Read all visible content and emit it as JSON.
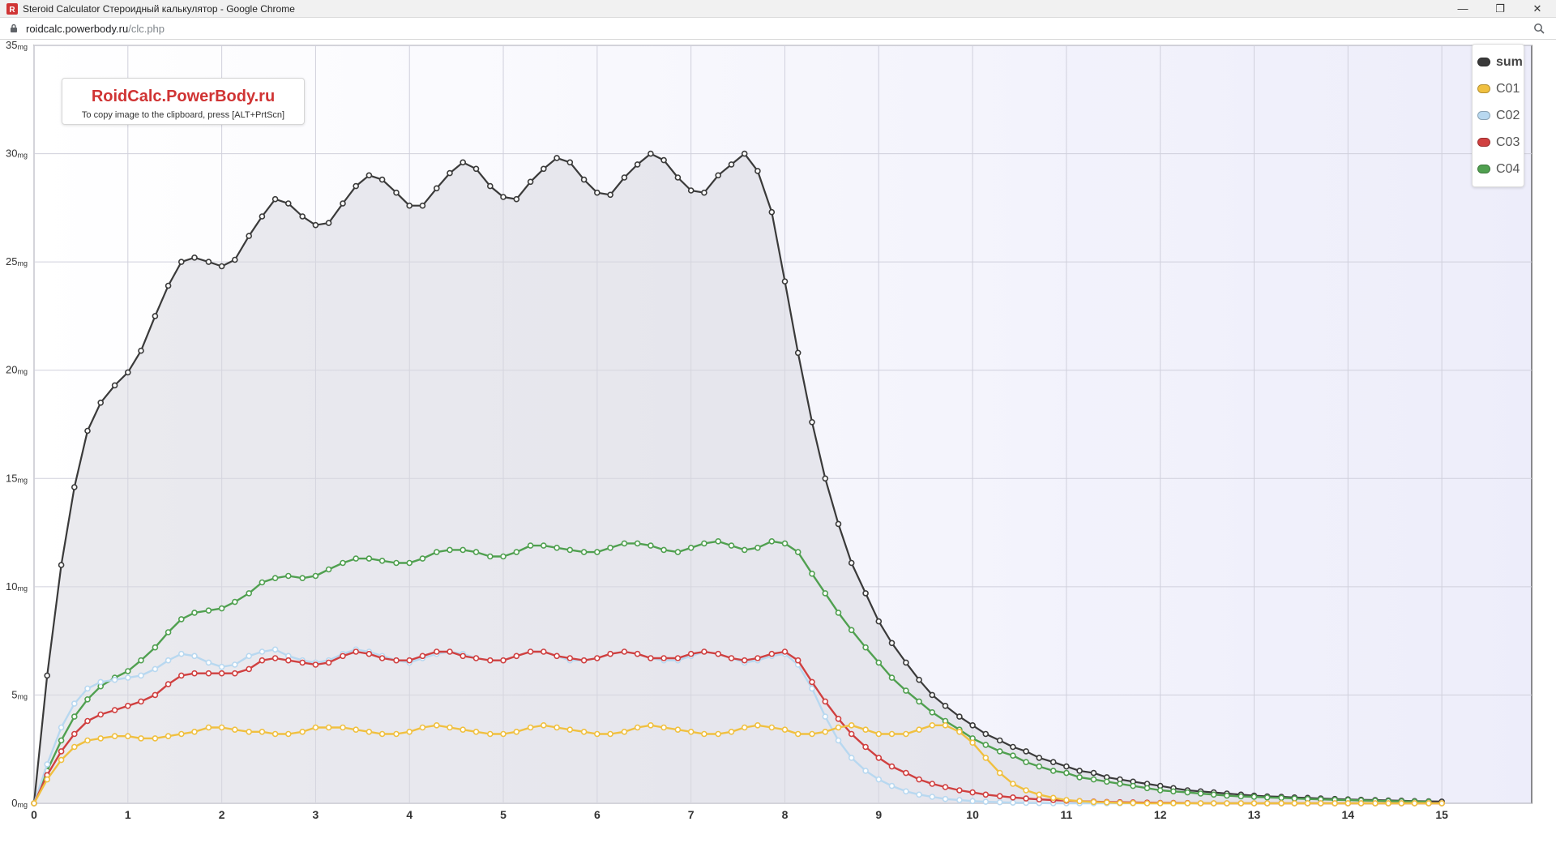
{
  "window": {
    "title": "Steroid Calculator Стероидный калькулятор - Google Chrome",
    "controls": [
      "—",
      "❐",
      "✕"
    ]
  },
  "address": {
    "host": "roidcalc.powerbody.ru",
    "path": "/clc.php"
  },
  "watermark": {
    "title": "RoidCalc.PowerBody.ru",
    "hint": "To copy image to the clipboard, press [ALT+PrtScn]"
  },
  "legend": [
    {
      "label": "sum",
      "color": "#3a3a3a"
    },
    {
      "label": "C01",
      "color": "#f0c040"
    },
    {
      "label": "C02",
      "color": "#b8d8f0"
    },
    {
      "label": "C03",
      "color": "#d04040"
    },
    {
      "label": "C04",
      "color": "#50a050"
    }
  ],
  "colors": {
    "sum": "#3a3a3a",
    "C01": "#f0c040",
    "C02": "#b8d8f0",
    "C03": "#d04040",
    "C04": "#50a050",
    "gridline": "#d0d0dc",
    "sum_fill": "#d8d8e0"
  },
  "chart_data": {
    "type": "line",
    "title": "",
    "xlabel": "",
    "ylabel": "",
    "xlim": [
      0,
      15
    ],
    "ylim": [
      0,
      35
    ],
    "x_ticks": [
      "0",
      "1",
      "2",
      "3",
      "4",
      "5",
      "6",
      "7",
      "8",
      "9",
      "10",
      "11",
      "12",
      "13",
      "14",
      "15"
    ],
    "y_ticks": [
      "0",
      "5",
      "10",
      "15",
      "20",
      "25",
      "30",
      "35"
    ],
    "y_unit": "mg",
    "grid": true,
    "legend_position": "top-right",
    "x": [
      0,
      0.14,
      0.29,
      0.43,
      0.57,
      0.71,
      0.86,
      1,
      1.14,
      1.29,
      1.43,
      1.57,
      1.71,
      1.86,
      2,
      2.14,
      2.29,
      2.43,
      2.57,
      2.71,
      2.86,
      3,
      3.14,
      3.29,
      3.43,
      3.57,
      3.71,
      3.86,
      4,
      4.14,
      4.29,
      4.43,
      4.57,
      4.71,
      4.86,
      5,
      5.14,
      5.29,
      5.43,
      5.57,
      5.71,
      5.86,
      6,
      6.14,
      6.29,
      6.43,
      6.57,
      6.71,
      6.86,
      7,
      7.14,
      7.29,
      7.43,
      7.57,
      7.71,
      7.86,
      8,
      8.14,
      8.29,
      8.43,
      8.57,
      8.71,
      8.86,
      9,
      9.14,
      9.29,
      9.43,
      9.57,
      9.71,
      9.86,
      10,
      10.14,
      10.29,
      10.43,
      10.57,
      10.71,
      10.86,
      11,
      11.14,
      11.29,
      11.43,
      11.57,
      11.71,
      11.86,
      12,
      12.14,
      12.29,
      12.43,
      12.57,
      12.71,
      12.86,
      13,
      13.14,
      13.29,
      13.43,
      13.57,
      13.71,
      13.86,
      14,
      14.14,
      14.29,
      14.43,
      14.57,
      14.71,
      14.86,
      15
    ],
    "series": [
      {
        "name": "sum",
        "values": [
          0,
          5.9,
          11.0,
          14.6,
          17.2,
          18.5,
          19.3,
          19.9,
          20.9,
          22.5,
          23.9,
          25.0,
          25.2,
          25.0,
          24.8,
          25.1,
          26.2,
          27.1,
          27.9,
          27.7,
          27.1,
          26.7,
          26.8,
          27.7,
          28.5,
          29.0,
          28.8,
          28.2,
          27.6,
          27.6,
          28.4,
          29.1,
          29.6,
          29.3,
          28.5,
          28.0,
          27.9,
          28.7,
          29.3,
          29.8,
          29.6,
          28.8,
          28.2,
          28.1,
          28.9,
          29.5,
          30.0,
          29.7,
          28.9,
          28.3,
          28.2,
          29.0,
          29.5,
          30.0,
          29.2,
          27.3,
          24.1,
          20.8,
          17.6,
          15.0,
          12.9,
          11.1,
          9.7,
          8.4,
          7.4,
          6.5,
          5.7,
          5.0,
          4.5,
          4.0,
          3.6,
          3.2,
          2.9,
          2.6,
          2.4,
          2.1,
          1.9,
          1.7,
          1.5,
          1.4,
          1.2,
          1.1,
          1.0,
          0.9,
          0.8,
          0.7,
          0.6,
          0.55,
          0.5,
          0.45,
          0.4,
          0.35,
          0.32,
          0.3,
          0.27,
          0.25,
          0.22,
          0.2,
          0.18,
          0.16,
          0.15,
          0.13,
          0.12,
          0.1,
          0.09,
          0.08
        ]
      },
      {
        "name": "C01",
        "values": [
          0,
          1.1,
          2.0,
          2.6,
          2.9,
          3.0,
          3.1,
          3.1,
          3.0,
          3.0,
          3.1,
          3.2,
          3.3,
          3.5,
          3.5,
          3.4,
          3.3,
          3.3,
          3.2,
          3.2,
          3.3,
          3.5,
          3.5,
          3.5,
          3.4,
          3.3,
          3.2,
          3.2,
          3.3,
          3.5,
          3.6,
          3.5,
          3.4,
          3.3,
          3.2,
          3.2,
          3.3,
          3.5,
          3.6,
          3.5,
          3.4,
          3.3,
          3.2,
          3.2,
          3.3,
          3.5,
          3.6,
          3.5,
          3.4,
          3.3,
          3.2,
          3.2,
          3.3,
          3.5,
          3.6,
          3.5,
          3.4,
          3.2,
          3.2,
          3.3,
          3.5,
          3.6,
          3.4,
          3.2,
          3.2,
          3.2,
          3.4,
          3.6,
          3.6,
          3.3,
          2.8,
          2.1,
          1.4,
          0.9,
          0.6,
          0.4,
          0.25,
          0.15,
          0.1,
          0.06,
          0.04,
          0.02,
          0.01,
          0,
          0,
          0,
          0,
          0,
          0,
          0,
          0,
          0,
          0,
          0,
          0,
          0,
          0,
          0,
          0,
          0,
          0,
          0,
          0,
          0,
          0,
          0
        ]
      },
      {
        "name": "C02",
        "values": [
          0,
          1.8,
          3.5,
          4.6,
          5.3,
          5.6,
          5.7,
          5.8,
          5.9,
          6.2,
          6.6,
          6.9,
          6.8,
          6.5,
          6.3,
          6.4,
          6.8,
          7.0,
          7.1,
          6.8,
          6.6,
          6.5,
          6.6,
          6.9,
          7.1,
          7.0,
          6.8,
          6.6,
          6.5,
          6.7,
          6.9,
          7.0,
          6.9,
          6.7,
          6.6,
          6.6,
          6.8,
          7.0,
          7.0,
          6.8,
          6.6,
          6.6,
          6.7,
          6.9,
          7.0,
          6.9,
          6.7,
          6.6,
          6.6,
          6.8,
          7.0,
          6.9,
          6.7,
          6.5,
          6.6,
          6.8,
          6.9,
          6.4,
          5.3,
          4.0,
          2.9,
          2.1,
          1.5,
          1.1,
          0.8,
          0.55,
          0.4,
          0.3,
          0.2,
          0.15,
          0.1,
          0.07,
          0.05,
          0.03,
          0.02,
          0.01,
          0,
          0,
          0,
          0,
          0,
          0,
          0,
          0,
          0,
          0,
          0,
          0,
          0,
          0,
          0,
          0,
          0,
          0,
          0,
          0,
          0,
          0,
          0,
          0,
          0,
          0,
          0,
          0,
          0,
          0
        ]
      },
      {
        "name": "C03",
        "values": [
          0,
          1.3,
          2.4,
          3.2,
          3.8,
          4.1,
          4.3,
          4.5,
          4.7,
          5.0,
          5.5,
          5.9,
          6.0,
          6.0,
          6.0,
          6.0,
          6.2,
          6.6,
          6.7,
          6.6,
          6.5,
          6.4,
          6.5,
          6.8,
          7.0,
          6.9,
          6.7,
          6.6,
          6.6,
          6.8,
          7.0,
          7.0,
          6.8,
          6.7,
          6.6,
          6.6,
          6.8,
          7.0,
          7.0,
          6.8,
          6.7,
          6.6,
          6.7,
          6.9,
          7.0,
          6.9,
          6.7,
          6.7,
          6.7,
          6.9,
          7.0,
          6.9,
          6.7,
          6.6,
          6.7,
          6.9,
          7.0,
          6.6,
          5.6,
          4.7,
          3.9,
          3.2,
          2.6,
          2.1,
          1.7,
          1.4,
          1.1,
          0.9,
          0.75,
          0.6,
          0.5,
          0.4,
          0.33,
          0.27,
          0.22,
          0.18,
          0.15,
          0.12,
          0.1,
          0.08,
          0.06,
          0.05,
          0.04,
          0.03,
          0.02,
          0.02,
          0.01,
          0,
          0,
          0,
          0,
          0,
          0,
          0,
          0,
          0,
          0,
          0,
          0,
          0,
          0,
          0,
          0,
          0,
          0,
          0
        ]
      },
      {
        "name": "C04",
        "values": [
          0,
          1.5,
          2.9,
          4.0,
          4.8,
          5.4,
          5.8,
          6.1,
          6.6,
          7.2,
          7.9,
          8.5,
          8.8,
          8.9,
          9.0,
          9.3,
          9.7,
          10.2,
          10.4,
          10.5,
          10.4,
          10.5,
          10.8,
          11.1,
          11.3,
          11.3,
          11.2,
          11.1,
          11.1,
          11.3,
          11.6,
          11.7,
          11.7,
          11.6,
          11.4,
          11.4,
          11.6,
          11.9,
          11.9,
          11.8,
          11.7,
          11.6,
          11.6,
          11.8,
          12.0,
          12.0,
          11.9,
          11.7,
          11.6,
          11.8,
          12.0,
          12.1,
          11.9,
          11.7,
          11.8,
          12.1,
          12.0,
          11.6,
          10.6,
          9.7,
          8.8,
          8.0,
          7.2,
          6.5,
          5.8,
          5.2,
          4.7,
          4.2,
          3.8,
          3.4,
          3.0,
          2.7,
          2.4,
          2.2,
          1.9,
          1.7,
          1.5,
          1.4,
          1.2,
          1.1,
          1.0,
          0.9,
          0.8,
          0.7,
          0.6,
          0.55,
          0.5,
          0.45,
          0.4,
          0.35,
          0.32,
          0.3,
          0.27,
          0.25,
          0.22,
          0.2,
          0.18,
          0.16,
          0.15,
          0.13,
          0.12,
          0.1,
          0.09,
          0.08,
          0.07
        ]
      }
    ]
  }
}
